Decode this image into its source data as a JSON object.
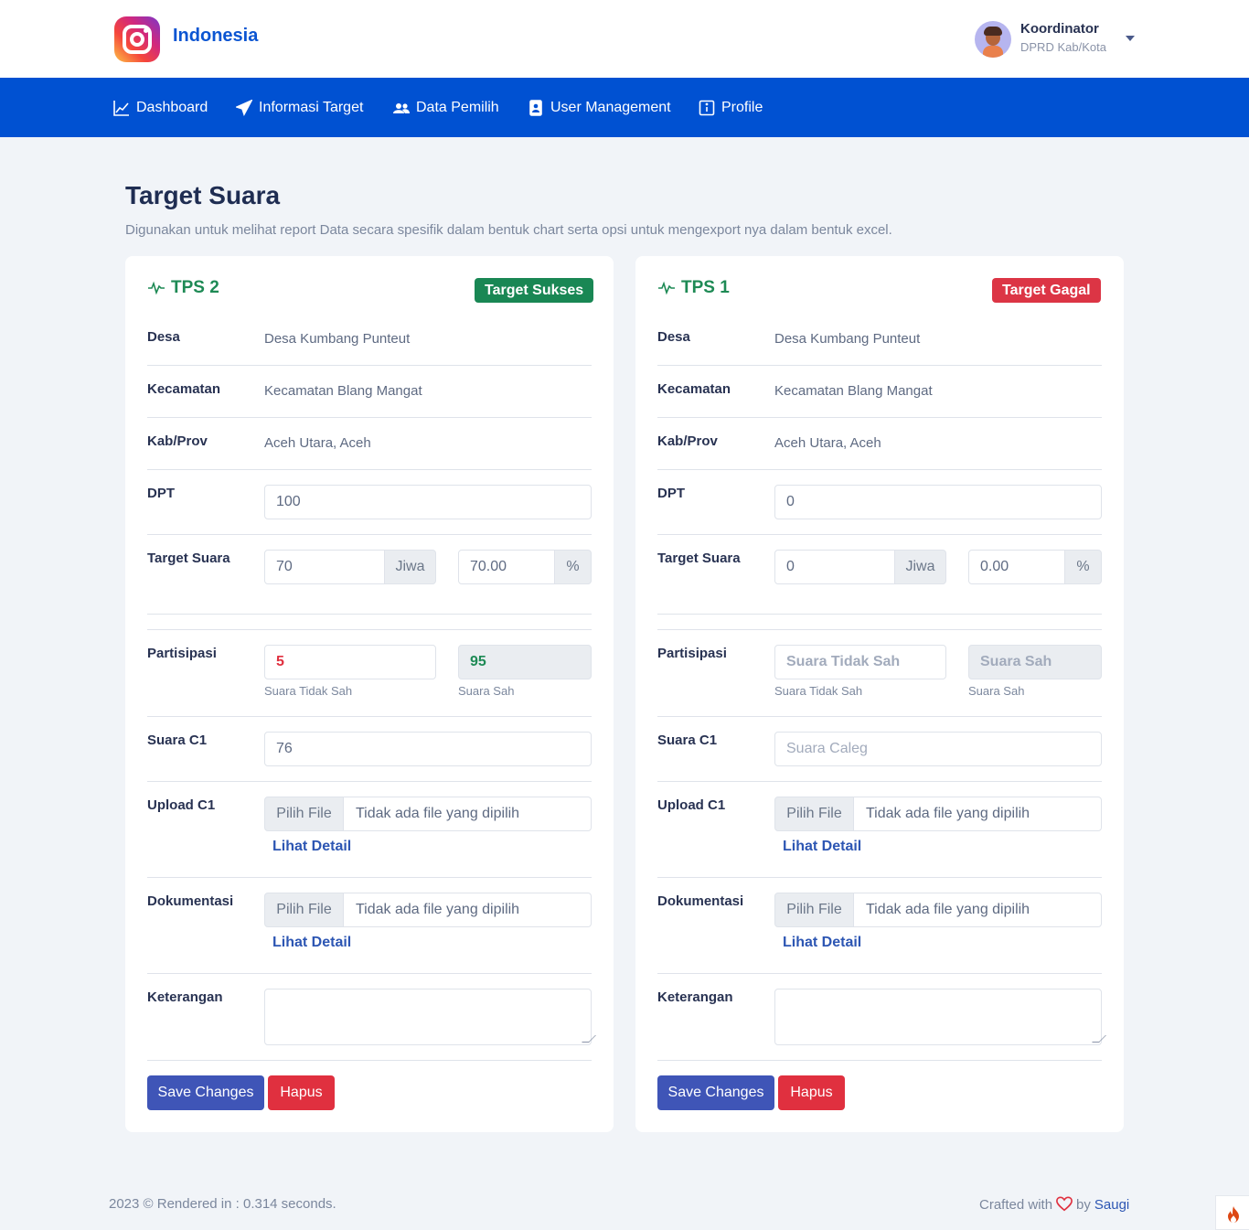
{
  "brand": {
    "name": "Indonesia"
  },
  "user": {
    "name": "Koordinator",
    "role": "DPRD Kab/Kota"
  },
  "nav": [
    {
      "label": "Dashboard",
      "icon": "chart-line-icon"
    },
    {
      "label": "Informasi Target",
      "icon": "send-icon"
    },
    {
      "label": "Data Pemilih",
      "icon": "users-icon"
    },
    {
      "label": "User Management",
      "icon": "id-badge-icon"
    },
    {
      "label": "Profile",
      "icon": "info-icon"
    }
  ],
  "page": {
    "title": "Target Suara",
    "description": "Digunakan untuk melihat report Data secara spesifik dalam bentuk chart serta opsi untuk mengexport nya dalam bentuk excel."
  },
  "labels": {
    "desa": "Desa",
    "kecamatan": "Kecamatan",
    "kabprov": "Kab/Prov",
    "dpt": "DPT",
    "target_suara": "Target Suara",
    "partisipasi": "Partisipasi",
    "suara_c1": "Suara C1",
    "upload_c1": "Upload C1",
    "dokumentasi": "Dokumentasi",
    "keterangan": "Keterangan",
    "jiwa": "Jiwa",
    "percent": "%",
    "suara_tidak_sah": "Suara Tidak Sah",
    "suara_sah": "Suara Sah",
    "pilih_file": "Pilih File",
    "no_file": "Tidak ada file yang dipilih",
    "lihat_detail": "Lihat Detail",
    "save": "Save Changes",
    "hapus": "Hapus"
  },
  "cards": [
    {
      "title": "TPS 2",
      "badge": "Target Sukses",
      "badge_color": "#198754",
      "desa": "Desa Kumbang Punteut",
      "kecamatan": "Kecamatan Blang Mangat",
      "kabprov": "Aceh Utara, Aceh",
      "dpt": "100",
      "target_jiwa": "70",
      "target_percent": "70.00",
      "tidak_sah": "5",
      "tidak_sah_placeholder": "Suara Tidak Sah",
      "sah": "95",
      "sah_placeholder": "Suara Sah",
      "suara_c1": "76",
      "suara_c1_placeholder": "Suara Caleg",
      "keterangan": ""
    },
    {
      "title": "TPS 1",
      "badge": "Target Gagal",
      "badge_color": "#dc3545",
      "desa": "Desa Kumbang Punteut",
      "kecamatan": "Kecamatan Blang Mangat",
      "kabprov": "Aceh Utara, Aceh",
      "dpt": "0",
      "target_jiwa": "0",
      "target_percent": "0.00",
      "tidak_sah": "",
      "tidak_sah_placeholder": "Suara Tidak Sah",
      "sah": "",
      "sah_placeholder": "Suara Sah",
      "suara_c1": "",
      "suara_c1_placeholder": "Suara Caleg",
      "keterangan": ""
    }
  ],
  "footer": {
    "left": "2023 © Rendered in : 0.314 seconds.",
    "crafted": "Crafted with",
    "by": "by",
    "author": "Saugi"
  }
}
